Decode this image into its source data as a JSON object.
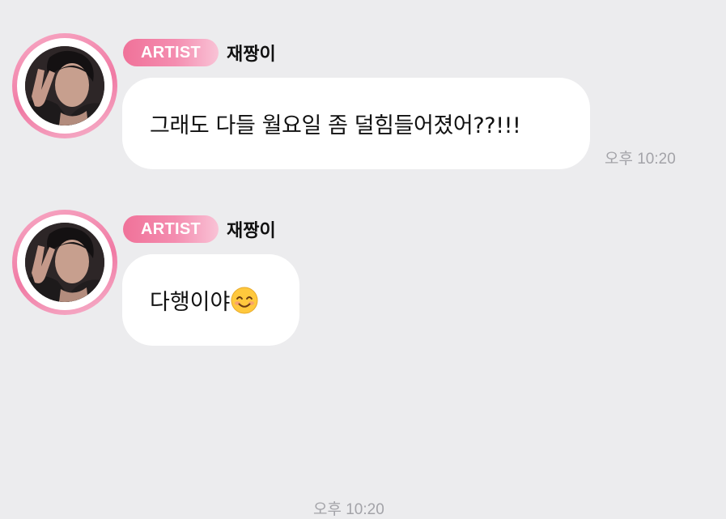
{
  "messages": [
    {
      "badge": "ARTIST",
      "author": "재짱이",
      "text": "그래도 다들 월요일 좀 덜힘들어졌어??!!!",
      "emoji": "",
      "time": "오후 10:20"
    },
    {
      "badge": "ARTIST",
      "author": "재짱이",
      "text": "다행이야",
      "emoji": "smiling-face-icon",
      "time": "오후 10:20"
    }
  ],
  "colors": {
    "background": "#ececee",
    "bubble": "#ffffff",
    "badge_start": "#f07299",
    "badge_end": "#f9c3d6",
    "avatar_ring": "#f07aa4",
    "timestamp": "#a3a3a8"
  }
}
